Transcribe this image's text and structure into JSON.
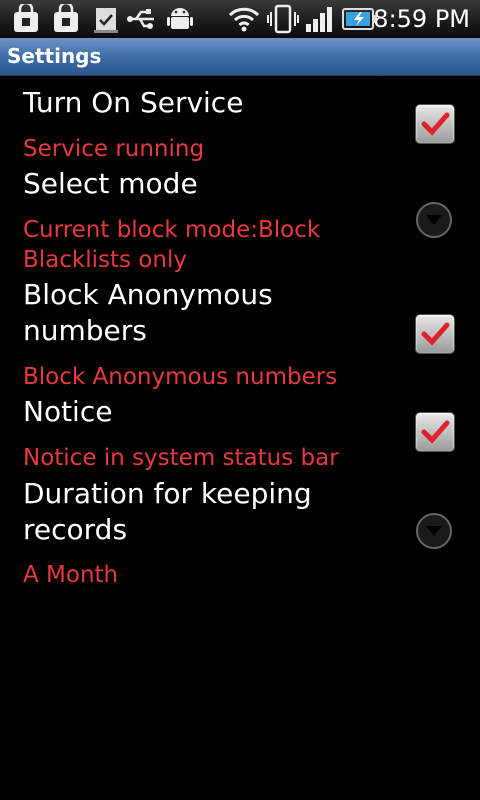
{
  "statusbar": {
    "time": "8:59 PM",
    "icons": [
      "lock-bag-icon",
      "lock-bag-icon",
      "clipboard-check-icon",
      "usb-icon",
      "android-icon",
      "wifi-icon",
      "vibrate-icon",
      "signal-icon",
      "battery-charging-icon"
    ]
  },
  "titlebar": {
    "title": "Settings"
  },
  "prefs": [
    {
      "title": "Turn On Service",
      "summary": "Service running",
      "widget": "checkbox",
      "checked": true
    },
    {
      "title": "Select mode",
      "summary": "Current block mode:Block Blacklists only",
      "widget": "dropdown"
    },
    {
      "title": "Block Anonymous numbers",
      "summary": "Block Anonymous numbers",
      "widget": "checkbox",
      "checked": true
    },
    {
      "title": "Notice",
      "summary": "Notice in system status bar",
      "widget": "checkbox",
      "checked": true
    },
    {
      "title": "Duration for keeping records",
      "summary": "A Month",
      "widget": "dropdown"
    }
  ],
  "colors": {
    "summary": "#e8383f",
    "title_bar": "#3f6ea8",
    "check": "#e0202a"
  }
}
